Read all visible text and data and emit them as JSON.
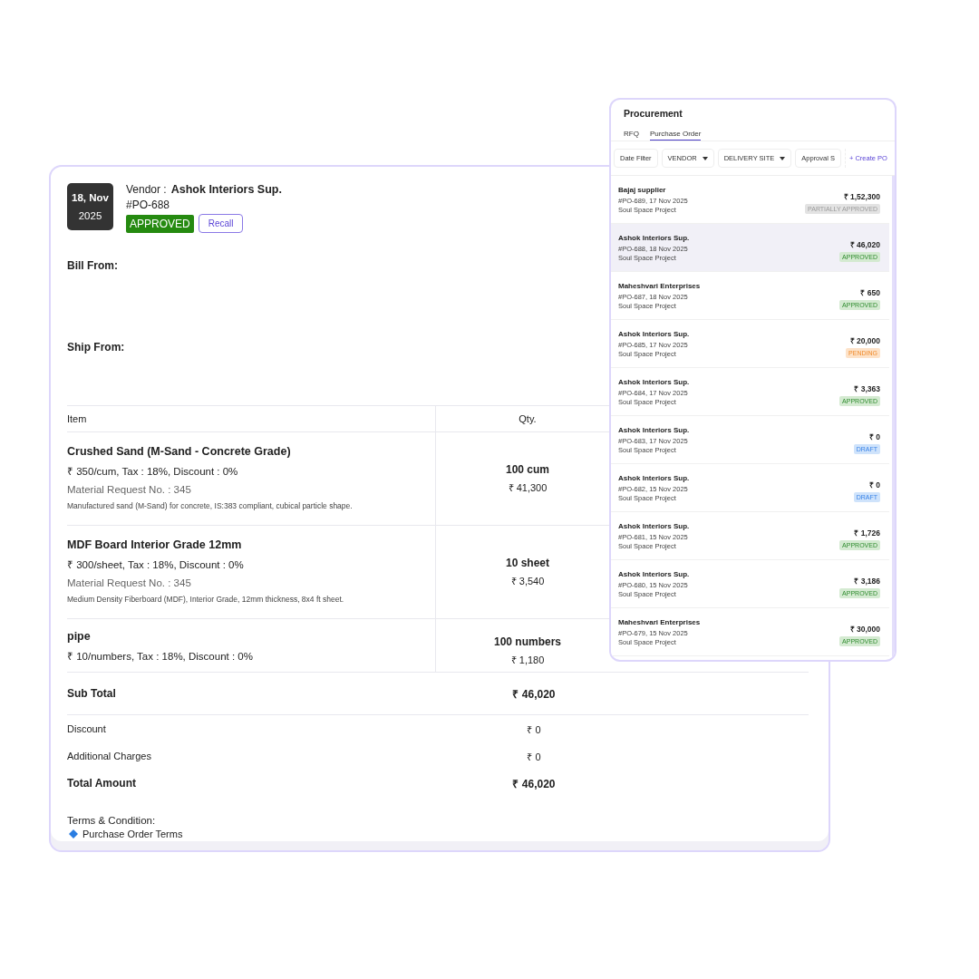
{
  "purchase_order": {
    "date_day": "18, Nov",
    "date_year": "2025",
    "vendor_label": "Vendor :",
    "vendor_name": "Ashok Interiors Sup.",
    "po_number": "#PO-688",
    "status": {
      "label": "APPROVED",
      "kind": "approved"
    },
    "recall_button": "Recall",
    "bill_from": "Bill From:",
    "ship_from": "Ship From:",
    "columns": [
      "Item",
      "Qty."
    ],
    "items": [
      {
        "name": "Crushed Sand (M-Sand - Concrete Grade)",
        "pricing": "₹ 350/cum, Tax : 18%, Discount : 0%",
        "request": "Material Request No. : 345",
        "description": "Manufactured sand (M-Sand) for concrete, IS:383 compliant, cubical particle shape.",
        "qty": "100 cum",
        "amount": "₹ 41,300"
      },
      {
        "name": "MDF Board Interior Grade 12mm",
        "pricing": "₹ 300/sheet, Tax : 18%, Discount : 0%",
        "request": "Material Request No. : 345",
        "description": "Medium Density Fiberboard (MDF), Interior Grade, 12mm thickness, 8x4 ft sheet.",
        "qty": "10 sheet",
        "amount": "₹ 3,540"
      },
      {
        "name": "pipe",
        "pricing": "₹ 10/numbers, Tax : 18%, Discount : 0%",
        "qty": "100 numbers",
        "amount": "₹ 1,180"
      }
    ],
    "totals": [
      {
        "label": "Sub Total",
        "value": "₹ 46,020",
        "kind": "strong"
      },
      {
        "label": "Discount",
        "value": "₹ 0",
        "kind": "plain"
      },
      {
        "label": "Additional Charges",
        "value": "₹ 0",
        "kind": "plain"
      },
      {
        "label": "Total Amount",
        "value": "₹ 46,020",
        "kind": "strong"
      }
    ],
    "terms_title": "Terms & Condition:",
    "terms_link": "Purchase Order Terms"
  },
  "procurement": {
    "title": "Procurement",
    "tabs": [
      {
        "label": "RFQ",
        "selected": false
      },
      {
        "label": "Purchase Order",
        "selected": true
      }
    ],
    "filters": [
      {
        "label": "Date Filter",
        "kind": "button"
      },
      {
        "label": "VENDOR",
        "kind": "dropdown"
      },
      {
        "label": "DELIVERY SITE",
        "kind": "dropdown"
      },
      {
        "label": "Approval S",
        "kind": "button"
      }
    ],
    "create_button": "+ Create PO",
    "orders": [
      {
        "vendor": "Bajaj supplier",
        "meta": "#PO-689, 17 Nov 2025",
        "project": "Soul Space Project",
        "amount": "₹ 1,52,300",
        "status": "PARTIALLY APPROVED",
        "kind": "partial",
        "selected": false
      },
      {
        "vendor": "Ashok Interiors Sup.",
        "meta": "#PO-688, 18 Nov 2025",
        "project": "Soul Space Project",
        "amount": "₹ 46,020",
        "status": "APPROVED",
        "kind": "approved",
        "selected": true
      },
      {
        "vendor": "Maheshvari Enterprises",
        "meta": "#PO-687, 18 Nov 2025",
        "project": "Soul Space Project",
        "amount": "₹ 650",
        "status": "APPROVED",
        "kind": "approved",
        "selected": false
      },
      {
        "vendor": "Ashok Interiors Sup.",
        "meta": "#PO-685, 17 Nov 2025",
        "project": "Soul Space Project",
        "amount": "₹ 20,000",
        "status": "PENDING",
        "kind": "pending",
        "selected": false
      },
      {
        "vendor": "Ashok Interiors Sup.",
        "meta": "#PO-684, 17 Nov 2025",
        "project": "Soul Space Project",
        "amount": "₹ 3,363",
        "status": "APPROVED",
        "kind": "approved",
        "selected": false
      },
      {
        "vendor": "Ashok Interiors Sup.",
        "meta": "#PO-683, 17 Nov 2025",
        "project": "Soul Space Project",
        "amount": "₹ 0",
        "status": "DRAFT",
        "kind": "draft",
        "selected": false
      },
      {
        "vendor": "Ashok Interiors Sup.",
        "meta": "#PO-682, 15 Nov 2025",
        "project": "Soul Space Project",
        "amount": "₹ 0",
        "status": "DRAFT",
        "kind": "draft",
        "selected": false
      },
      {
        "vendor": "Ashok Interiors Sup.",
        "meta": "#PO-681, 15 Nov 2025",
        "project": "Soul Space Project",
        "amount": "₹ 1,726",
        "status": "APPROVED",
        "kind": "approved",
        "selected": false
      },
      {
        "vendor": "Ashok Interiors Sup.",
        "meta": "#PO-680, 15 Nov 2025",
        "project": "Soul Space Project",
        "amount": "₹ 3,186",
        "status": "APPROVED",
        "kind": "approved",
        "selected": false
      },
      {
        "vendor": "Maheshvari Enterprises",
        "meta": "#PO-679, 15 Nov 2025",
        "project": "Soul Space Project",
        "amount": "₹ 30,000",
        "status": "APPROVED",
        "kind": "approved",
        "selected": false
      }
    ]
  }
}
